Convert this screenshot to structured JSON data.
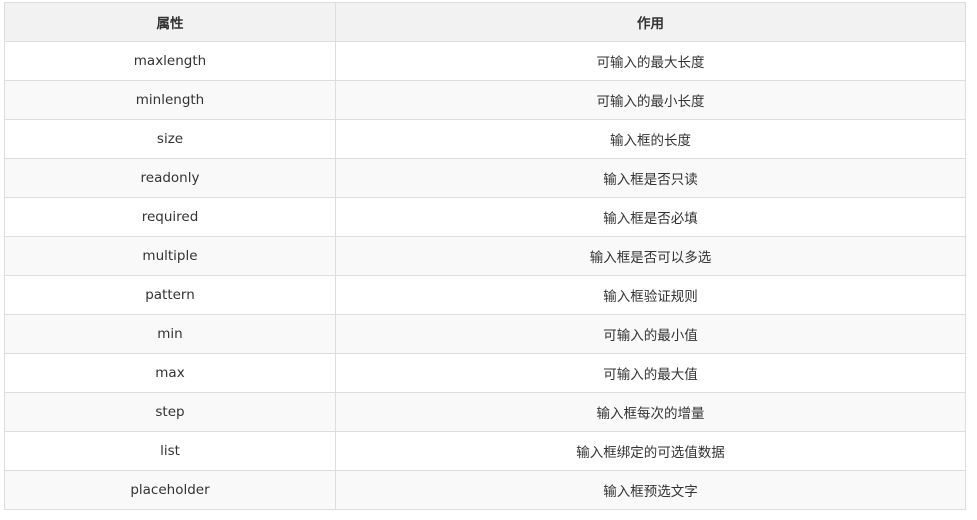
{
  "table": {
    "headers": [
      "属性",
      "作用"
    ],
    "rows": [
      {
        "attr": "maxlength",
        "desc": "可输入的最大长度"
      },
      {
        "attr": "minlength",
        "desc": "可输入的最小长度"
      },
      {
        "attr": "size",
        "desc": "输入框的长度"
      },
      {
        "attr": "readonly",
        "desc": "输入框是否只读"
      },
      {
        "attr": "required",
        "desc": "输入框是否必填"
      },
      {
        "attr": "multiple",
        "desc": "输入框是否可以多选"
      },
      {
        "attr": "pattern",
        "desc": "输入框验证规则"
      },
      {
        "attr": "min",
        "desc": "可输入的最小值"
      },
      {
        "attr": "max",
        "desc": "可输入的最大值"
      },
      {
        "attr": "step",
        "desc": "输入框每次的增量"
      },
      {
        "attr": "list",
        "desc": "输入框绑定的可选值数据"
      },
      {
        "attr": "placeholder",
        "desc": "输入框预选文字"
      }
    ]
  }
}
